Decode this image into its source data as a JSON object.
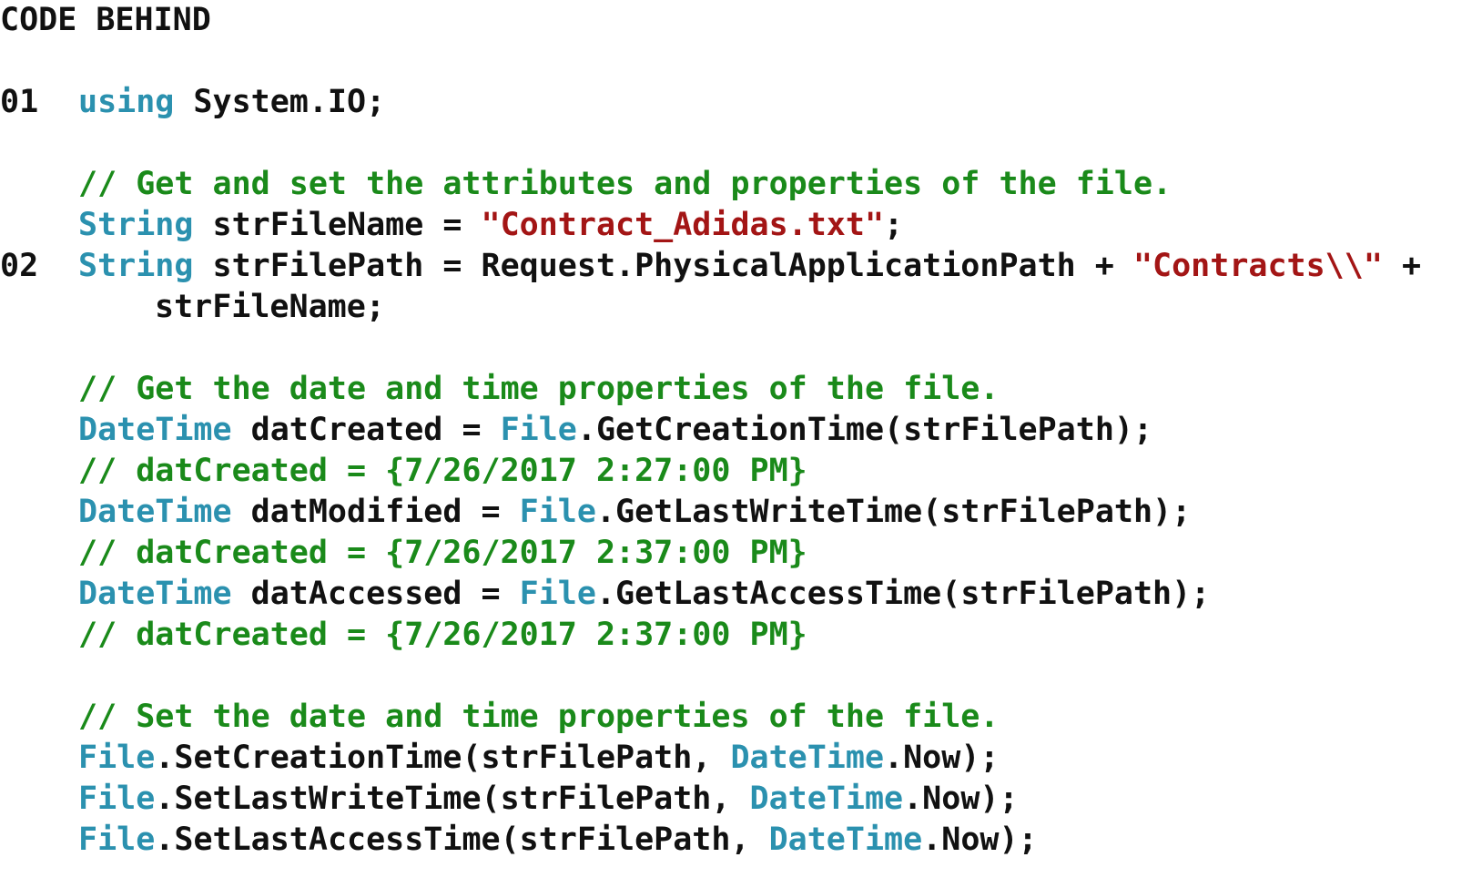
{
  "heading": "CODE BEHIND",
  "lines": [
    {
      "no": "01",
      "tokens": [
        {
          "t": "using",
          "c": "kw"
        },
        {
          "t": " System.IO;",
          "c": "pl"
        }
      ]
    },
    {
      "no": "",
      "tokens": [
        {
          "t": "// Get and set the attributes and properties of the file.",
          "c": "cm"
        }
      ]
    },
    {
      "no": "",
      "tokens": [
        {
          "t": "String",
          "c": "kw"
        },
        {
          "t": " strFileName = ",
          "c": "pl"
        },
        {
          "t": "\"Contract_Adidas.txt\"",
          "c": "st"
        },
        {
          "t": ";",
          "c": "pl"
        }
      ]
    },
    {
      "no": "02",
      "tokens": [
        {
          "t": "String",
          "c": "kw"
        },
        {
          "t": " strFilePath = Request.PhysicalApplicationPath + ",
          "c": "pl"
        },
        {
          "t": "\"Contracts\\\\\"",
          "c": "st"
        },
        {
          "t": " +",
          "c": "pl"
        }
      ]
    },
    {
      "no": "",
      "tokens": [
        {
          "t": "strFileName;",
          "c": "pl"
        }
      ]
    },
    {
      "no": "",
      "tokens": [
        {
          "t": "// Get the date and time properties of the file.",
          "c": "cm"
        }
      ]
    },
    {
      "no": "",
      "tokens": [
        {
          "t": "DateTime",
          "c": "kw"
        },
        {
          "t": " datCreated = ",
          "c": "pl"
        },
        {
          "t": "File",
          "c": "kw"
        },
        {
          "t": ".GetCreationTime(strFilePath);",
          "c": "pl"
        }
      ]
    },
    {
      "no": "",
      "tokens": [
        {
          "t": "// datCreated = {7/26/2017 2:27:00 PM}",
          "c": "cm"
        }
      ]
    },
    {
      "no": "",
      "tokens": [
        {
          "t": "DateTime",
          "c": "kw"
        },
        {
          "t": " datModified = ",
          "c": "pl"
        },
        {
          "t": "File",
          "c": "kw"
        },
        {
          "t": ".GetLastWriteTime(strFilePath);",
          "c": "pl"
        }
      ]
    },
    {
      "no": "",
      "tokens": [
        {
          "t": "// datCreated = {7/26/2017 2:37:00 PM}",
          "c": "cm"
        }
      ]
    },
    {
      "no": "",
      "tokens": [
        {
          "t": "DateTime",
          "c": "kw"
        },
        {
          "t": " datAccessed = ",
          "c": "pl"
        },
        {
          "t": "File",
          "c": "kw"
        },
        {
          "t": ".GetLastAccessTime(strFilePath);",
          "c": "pl"
        }
      ]
    },
    {
      "no": "",
      "tokens": [
        {
          "t": "// datCreated = {7/26/2017 2:37:00 PM}",
          "c": "cm"
        }
      ]
    },
    {
      "no": "",
      "tokens": [
        {
          "t": "// Set the date and time properties of the file.",
          "c": "cm"
        }
      ]
    },
    {
      "no": "",
      "tokens": [
        {
          "t": "File",
          "c": "kw"
        },
        {
          "t": ".SetCreationTime(strFilePath, ",
          "c": "pl"
        },
        {
          "t": "DateTime",
          "c": "kw"
        },
        {
          "t": ".Now);",
          "c": "pl"
        }
      ]
    },
    {
      "no": "",
      "tokens": [
        {
          "t": "File",
          "c": "kw"
        },
        {
          "t": ".SetLastWriteTime(strFilePath, ",
          "c": "pl"
        },
        {
          "t": "DateTime",
          "c": "kw"
        },
        {
          "t": ".Now);",
          "c": "pl"
        }
      ]
    },
    {
      "no": "",
      "tokens": [
        {
          "t": "File",
          "c": "kw"
        },
        {
          "t": ".SetLastAccessTime(strFilePath, ",
          "c": "pl"
        },
        {
          "t": "DateTime",
          "c": "kw"
        },
        {
          "t": ".Now);",
          "c": "pl"
        }
      ]
    }
  ],
  "colors": {
    "keyword": "#2b91af",
    "comment": "#1a8a1a",
    "string": "#a31515",
    "plain": "#111111"
  }
}
